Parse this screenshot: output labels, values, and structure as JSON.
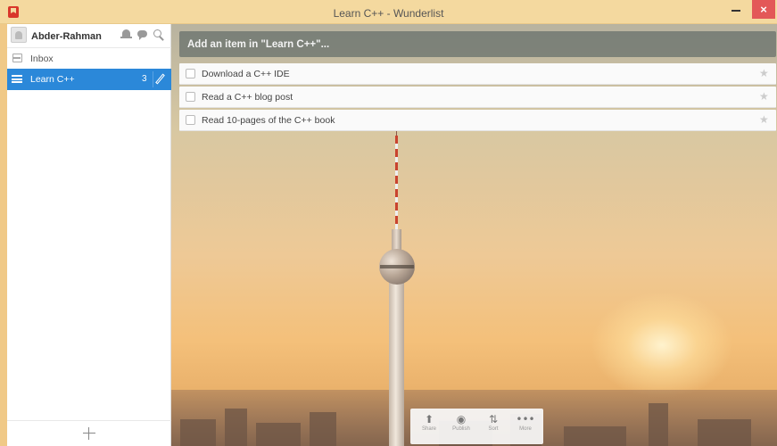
{
  "window": {
    "title": "Learn C++ - Wunderlist",
    "close_glyph": "×"
  },
  "sidebar": {
    "user_name": "Abder-Rahman",
    "items": [
      {
        "label": "Inbox",
        "icon": "inbox-icon"
      },
      {
        "label": "Learn C++",
        "icon": "hamburger-icon",
        "count": "3",
        "active": true
      }
    ]
  },
  "main": {
    "add_placeholder": "Add an item in \"Learn C++\"...",
    "tasks": [
      {
        "text": "Download a C++ IDE",
        "completed": false,
        "starred": false
      },
      {
        "text": "Read a C++ blog post",
        "completed": false,
        "starred": false
      },
      {
        "text": "Read 10-pages of the C++ book",
        "completed": false,
        "starred": false
      }
    ],
    "star_glyph": "★"
  },
  "toolbar": {
    "share": {
      "label": "Share",
      "glyph": "⬆"
    },
    "publish": {
      "label": "Publish",
      "glyph": "◉"
    },
    "sort": {
      "label": "Sort",
      "glyph": "⇅"
    },
    "more": {
      "label": "More",
      "glyph": "•••"
    }
  },
  "colors": {
    "accent": "#2b88d9",
    "titlebar": "#f4d99f",
    "close_button": "#e35858"
  }
}
